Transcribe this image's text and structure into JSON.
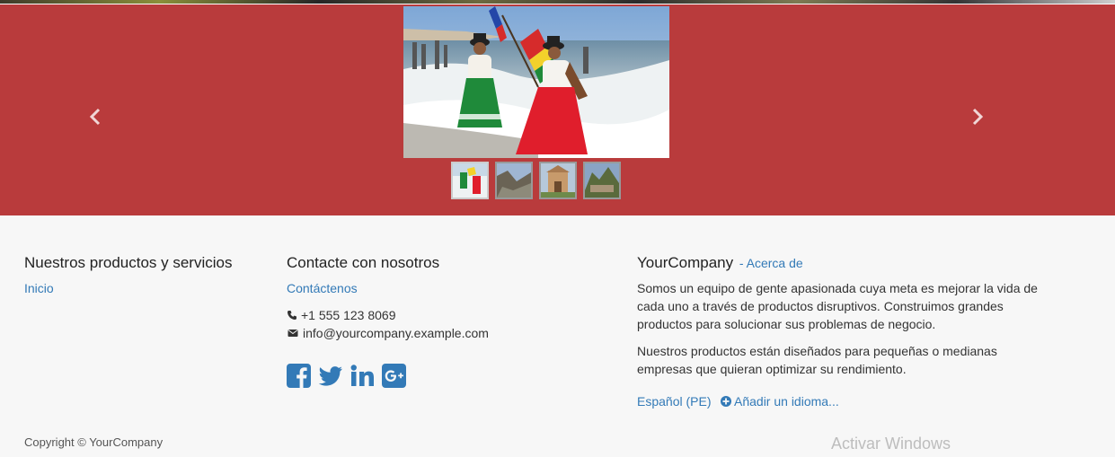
{
  "carousel": {
    "prev_icon": "chevron-left-icon",
    "next_icon": "chevron-right-icon",
    "thumbnails": [
      "thumb-1",
      "thumb-2",
      "thumb-3",
      "thumb-4"
    ]
  },
  "footer": {
    "products": {
      "title": "Nuestros productos y servicios",
      "links": [
        "Inicio"
      ]
    },
    "contact": {
      "title": "Contacte con nosotros",
      "link": "Contáctenos",
      "phone": "+1 555 123 8069",
      "email": "info@yourcompany.example.com",
      "social_icons": [
        "facebook-icon",
        "twitter-icon",
        "linkedin-icon",
        "google-plus-icon"
      ]
    },
    "about": {
      "company": "YourCompany",
      "about_link": "- Acerca de",
      "paragraph1": "Somos un equipo de gente apasionada cuya meta es mejorar la vida de cada uno a través de productos disruptivos. Construimos grandes productos para solucionar sus problemas de negocio.",
      "paragraph2": "Nuestros productos están diseñados para pequeñas o medianas empresas que quieran optimizar su rendimiento.",
      "language": "Español (PE)",
      "add_language": "Añadir un idioma..."
    },
    "copyright": "Copyright © YourCompany"
  },
  "os_watermark": "Activar Windows",
  "colors": {
    "carousel_bg": "#b93b3c",
    "link": "#337ab7",
    "footer_bg": "#f7f7f7"
  }
}
